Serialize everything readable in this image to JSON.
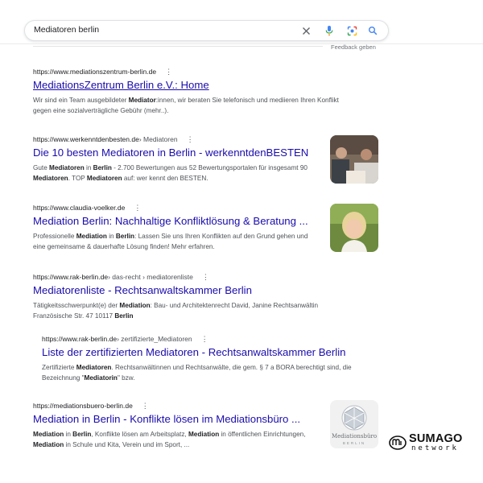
{
  "search": {
    "query": "Mediatoren berlin"
  },
  "feedback_label": "Feedback geben",
  "results": [
    {
      "url": "https://www.mediationszentrum-berlin.de",
      "crumb": "",
      "title": "MediationsZentrum Berlin e.V.: Home",
      "snippet_html": "Wir sind ein Team ausgebildeter <b>Mediator</b>:innen, wir beraten Sie telefonisch und mediieren Ihren Konflikt gegen eine sozialverträgliche Gebühr (mehr..)."
    },
    {
      "url": "https://www.werkenntdenbesten.de",
      "crumb": " › Mediatoren",
      "title": "Die 10 besten Mediatoren in Berlin - werkenntdenBESTEN",
      "snippet_html": "Gute <b>Mediatoren</b> in <b>Berlin</b> - 2.700 Bewertungen aus 52 Bewertungsportalen für insgesamt 90 <b>Mediatoren</b>. TOP <b>Mediatoren</b> auf: wer kennt den BESTEN."
    },
    {
      "url": "https://www.claudia-voelker.de",
      "crumb": "",
      "title": "Mediation Berlin: Nachhaltige Konfliktlösung & Beratung ...",
      "snippet_html": "Professionelle <b>Mediation</b> in <b>Berlin</b>: Lassen Sie uns Ihren Konflikten auf den Grund gehen und eine gemeinsame & dauerhafte Lösung finden! Mehr erfahren."
    },
    {
      "url": "https://www.rak-berlin.de",
      "crumb": " › das-recht › mediatorenliste",
      "title": "Mediatorenliste - Rechtsanwaltskammer Berlin",
      "snippet_html": "Tätigkeitsschwerpunkt(e) der <b>Mediation</b>: Bau- und Architektenrecht David, Janine Rechtsanwältin Französische Str. 47 10117 <b>Berlin</b>"
    },
    {
      "url": "https://www.rak-berlin.de",
      "crumb": " › zertifizierte_Mediatoren",
      "title": "Liste der zertifizierten Mediatoren - Rechtsanwaltskammer Berlin",
      "snippet_html": "Zertifizierte <b>Mediatoren</b>. Rechtsanwältinnen und Rechtsanwälte, die gem. § 7 a BORA berechtigt sind, die Bezeichnung \"<b>Mediatorin</b>\" bzw."
    },
    {
      "url": "https://mediationsbuero-berlin.de",
      "crumb": "",
      "title": "Mediation in Berlin - Konflikte lösen im Mediationsbüro ...",
      "snippet_html": "<b>Mediation</b> in <b>Berlin</b>, Konflikte lösen am Arbeitsplatz, <b>Mediation</b> in öffentlichen Einrichtungen, <b>Mediation</b> in Schule und Kita, Verein und im Sport, ..."
    }
  ],
  "thumb_logo": {
    "line1": "Mediationsbüro",
    "line2": "BERLIN"
  },
  "watermark": {
    "word": "SUMAGO",
    "sub": "network"
  },
  "icons": {
    "clear": "close-icon",
    "voice": "microphone-icon",
    "lens": "camera-lens-icon",
    "search": "search-icon",
    "more": "more-vert-icon"
  },
  "colors": {
    "link": "#1a0dab",
    "url": "#202124",
    "snippet": "#4d5156",
    "mic_blue": "#4285f4",
    "mic_red": "#ea4335"
  }
}
